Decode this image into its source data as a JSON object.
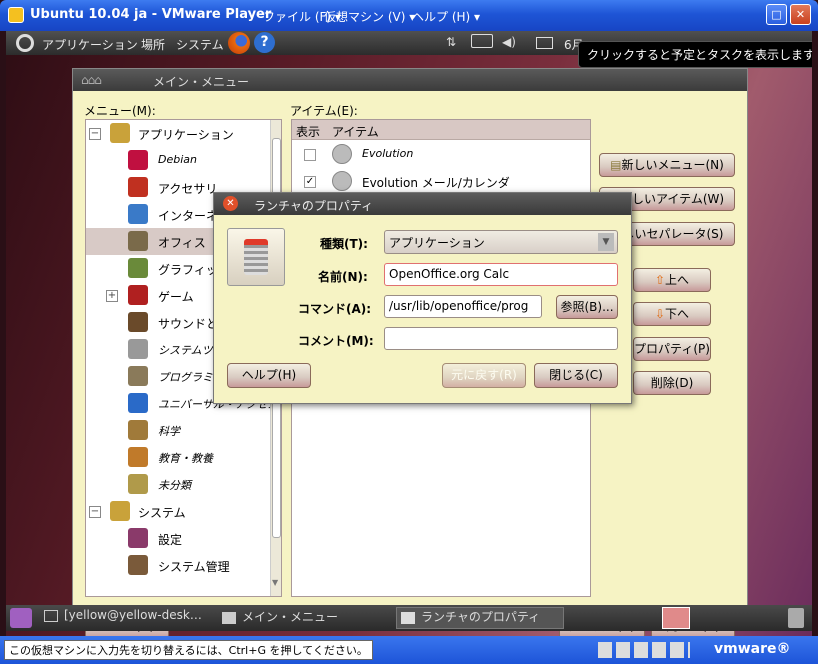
{
  "vm": {
    "title": "Ubuntu 10.04 ja - VMware Player",
    "menu": [
      "ファイル (F) ▾",
      "仮想マシン (V) ▾",
      "ヘルプ (H) ▾"
    ],
    "status_msg": "この仮想マシンに入力先を切り替えるには、Ctrl+G を押してください。",
    "brand": "vmware®"
  },
  "panel": {
    "menus": [
      "アプリケーション",
      "場所",
      "システム"
    ],
    "clock": "6月",
    "tooltip": "クリックすると予定とタスクを表示します"
  },
  "main": {
    "title": "メイン・メニュー",
    "menu_label": "メニュー(M):",
    "items_label": "アイテム(E):",
    "col_show": "表示",
    "col_item": "アイテム",
    "tree": [
      {
        "label": "アプリケーション",
        "expander": "−",
        "indent": 0,
        "color": "#c9a23a"
      },
      {
        "label": "Debian",
        "indent": 1,
        "italic": true,
        "color": "#c01040"
      },
      {
        "label": "アクセサリ",
        "indent": 1,
        "color": "#c03020"
      },
      {
        "label": "インターネ",
        "indent": 1,
        "color": "#3a7ac8"
      },
      {
        "label": "オフィス",
        "indent": 1,
        "selected": true,
        "color": "#7a6a4a"
      },
      {
        "label": "グラフィック",
        "indent": 1,
        "color": "#6a8a3a"
      },
      {
        "label": "ゲーム",
        "expander": "+",
        "indent": 1,
        "color": "#b02020"
      },
      {
        "label": "サウンドとビ",
        "indent": 1,
        "color": "#6a4a2a"
      },
      {
        "label": "システムツー",
        "indent": 1,
        "italic": true,
        "color": "#999999"
      },
      {
        "label": "プログラミン",
        "indent": 1,
        "italic": true,
        "color": "#8a7a5a"
      },
      {
        "label": "ユニバーサル・アクセス",
        "indent": 1,
        "italic": true,
        "color": "#2a6ac8"
      },
      {
        "label": "科学",
        "indent": 1,
        "italic": true,
        "color": "#a07a3a"
      },
      {
        "label": "教育・教養",
        "indent": 1,
        "italic": true,
        "color": "#c07a2a"
      },
      {
        "label": "未分類",
        "indent": 1,
        "italic": true,
        "color": "#b09a4a"
      },
      {
        "label": "システム",
        "expander": "−",
        "indent": 0,
        "color": "#c9a23a"
      },
      {
        "label": "設定",
        "indent": 1,
        "color": "#8a3a6a"
      },
      {
        "label": "システム管理",
        "indent": 1,
        "color": "#7a5a3a"
      }
    ],
    "items": [
      {
        "label": "Evolution",
        "checked": false,
        "italic": true
      },
      {
        "label": "Evolution メール/カレンダ",
        "checked": true,
        "italic": false
      }
    ],
    "buttons": {
      "new_menu": "新しいメニュー(N)",
      "new_item": "新しいアイテム(W)",
      "new_sep": "新しいセパレータ(S)",
      "up": "上へ",
      "down": "下へ",
      "props": "プロパティ(P)",
      "delete": "削除(D)",
      "help": "ヘルプ(H)",
      "revert": "元に戻す(R)",
      "close": "閉じる(C)"
    }
  },
  "dialog": {
    "title": "ランチャのプロパティ",
    "type_label": "種類(T):",
    "type_value": "アプリケーション",
    "name_label": "名前(N):",
    "name_value": "OpenOffice.org Calc",
    "cmd_label": "コマンド(A):",
    "cmd_value": "/usr/lib/openoffice/prog",
    "browse": "参照(B)...",
    "comment_label": "コメント(M):",
    "comment_value": "",
    "help": "ヘルプ(H)",
    "revert": "元に戻す(R)",
    "close": "閉じる(C)"
  },
  "taskbar": {
    "items": [
      "[yellow@yellow-desk…",
      "メイン・メニュー",
      "ランチャのプロパティ"
    ]
  }
}
